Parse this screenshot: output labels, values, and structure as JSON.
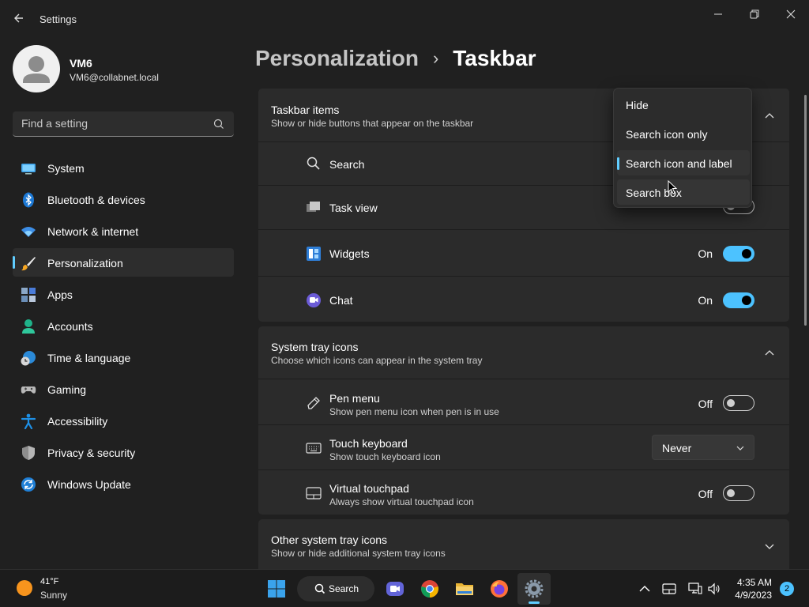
{
  "window": {
    "title": "Settings"
  },
  "user": {
    "name": "VM6",
    "email": "VM6@collabnet.local"
  },
  "sidebar": {
    "search_placeholder": "Find a setting",
    "items": [
      {
        "label": "System",
        "icon": "monitor-icon"
      },
      {
        "label": "Bluetooth & devices",
        "icon": "bluetooth-icon"
      },
      {
        "label": "Network & internet",
        "icon": "wifi-icon"
      },
      {
        "label": "Personalization",
        "icon": "brush-icon",
        "active": true
      },
      {
        "label": "Apps",
        "icon": "apps-icon"
      },
      {
        "label": "Accounts",
        "icon": "person-icon"
      },
      {
        "label": "Time & language",
        "icon": "globe-clock-icon"
      },
      {
        "label": "Gaming",
        "icon": "gamepad-icon"
      },
      {
        "label": "Accessibility",
        "icon": "accessibility-icon"
      },
      {
        "label": "Privacy & security",
        "icon": "shield-icon"
      },
      {
        "label": "Windows Update",
        "icon": "update-icon"
      }
    ]
  },
  "breadcrumb": {
    "parent": "Personalization",
    "separator": "›",
    "current": "Taskbar"
  },
  "taskbar_items": {
    "title": "Taskbar items",
    "subtitle": "Show or hide buttons that appear on the taskbar",
    "rows": [
      {
        "label": "Search"
      },
      {
        "label": "Task view"
      },
      {
        "label": "Widgets",
        "state": "On",
        "on": true
      },
      {
        "label": "Chat",
        "state": "On",
        "on": true
      }
    ]
  },
  "search_dropdown": {
    "options": [
      "Hide",
      "Search icon only",
      "Search icon and label",
      "Search box"
    ],
    "selected": "Search icon and label"
  },
  "system_tray": {
    "title": "System tray icons",
    "subtitle": "Choose which icons can appear in the system tray",
    "rows": [
      {
        "label": "Pen menu",
        "sub": "Show pen menu icon when pen is in use",
        "state": "Off"
      },
      {
        "label": "Touch keyboard",
        "sub": "Show touch keyboard icon",
        "value": "Never"
      },
      {
        "label": "Virtual touchpad",
        "sub": "Always show virtual touchpad icon",
        "state": "Off"
      }
    ]
  },
  "other_tray": {
    "title": "Other system tray icons",
    "subtitle": "Show or hide additional system tray icons"
  },
  "taskbar": {
    "weather_temp": "41°F",
    "weather_cond": "Sunny",
    "search_label": "Search",
    "time": "4:35 AM",
    "date": "4/9/2023",
    "notifications": "2"
  },
  "colors": {
    "accent": "#4cc2ff",
    "background": "#202020",
    "card": "#2b2b2b"
  }
}
